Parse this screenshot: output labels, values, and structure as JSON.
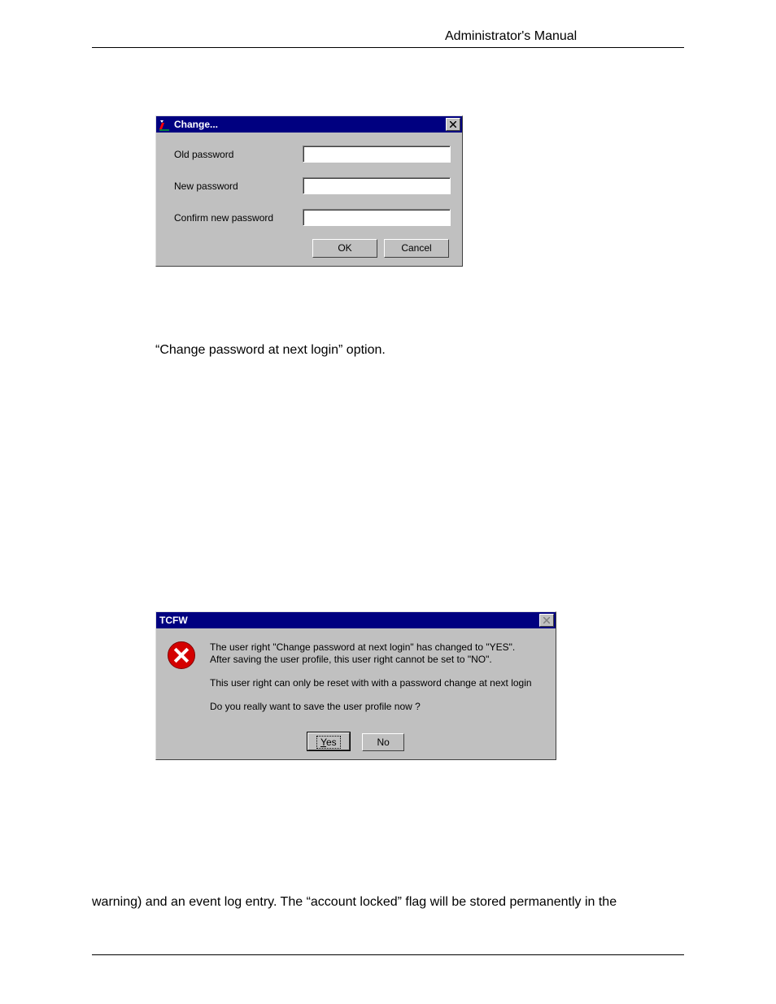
{
  "header": {
    "title": "Administrator's Manual"
  },
  "dialog1": {
    "title": "Change...",
    "fields": {
      "old_password_label": "Old password",
      "old_password_value": "",
      "new_password_label": "New password",
      "new_password_value": "",
      "confirm_password_label": "Confirm new password",
      "confirm_password_value": ""
    },
    "buttons": {
      "ok": "OK",
      "cancel": "Cancel"
    },
    "icons": {
      "app_icon": "user-edit-icon",
      "close": "close-icon"
    }
  },
  "body_text_1": "“Change password at next login” option.",
  "dialog2": {
    "title": "TCFW",
    "message_line1": "The user right \"Change password at next login\" has changed to \"YES\".",
    "message_line2": "After saving the user profile, this user right cannot be set to \"NO\".",
    "message_line3": "This user right can only be reset with with a password change at next login",
    "message_line4": "Do you really want to save the user profile now ?",
    "buttons": {
      "yes": "Yes",
      "no": "No"
    },
    "icons": {
      "stop": "error-icon",
      "close": "close-icon"
    }
  },
  "body_text_2": "warning) and an event log entry. The “account locked” flag will be stored permanently in the"
}
